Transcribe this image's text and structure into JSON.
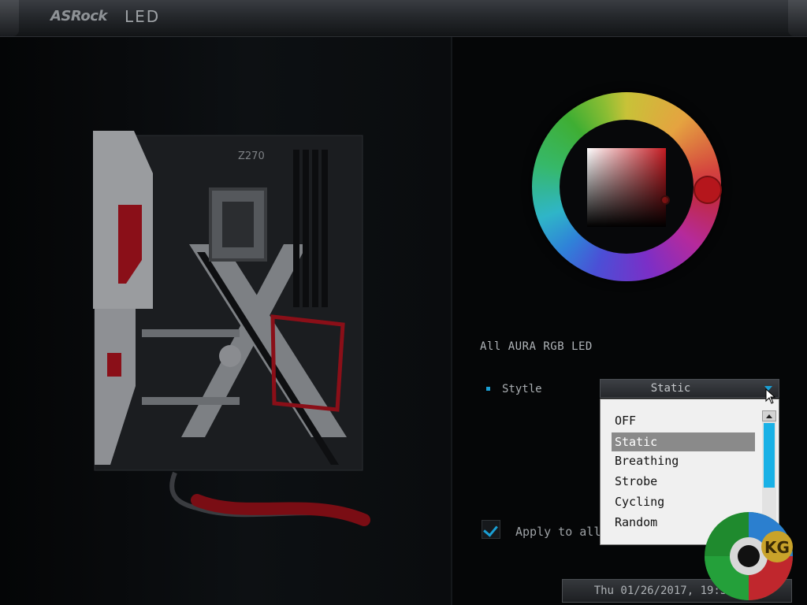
{
  "header": {
    "brand": "ASRock",
    "title": "LED"
  },
  "board": {
    "model_text": "Z270"
  },
  "color_picker": {
    "selected_color": "#c41b22"
  },
  "settings": {
    "section_title": "All AURA RGB LED",
    "style_label": "Stytle",
    "style_value": "Static",
    "apply_label": "Apply to all",
    "apply_checked": true
  },
  "dropdown": {
    "options": [
      "OFF",
      "Static",
      "Breathing",
      "Strobe",
      "Cycling",
      "Random"
    ],
    "selected": "Static"
  },
  "status": {
    "datetime": "Thu 01/26/2017, 19:52:43"
  },
  "watermark": {
    "text": "KG"
  },
  "colors": {
    "accent": "#1a9fd4",
    "led_red": "#c41b22"
  }
}
